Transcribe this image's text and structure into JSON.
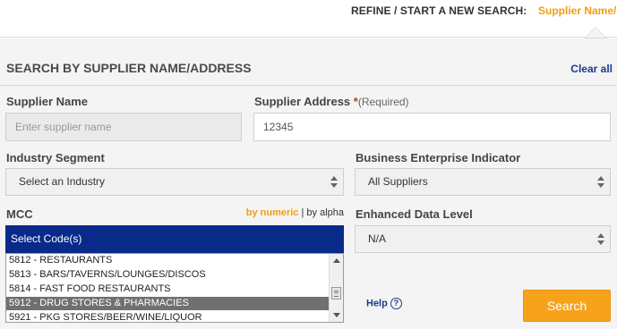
{
  "topbar": {
    "refine_label": "REFINE / START A NEW SEARCH:",
    "active_tab": "Supplier Name/"
  },
  "panel": {
    "title": "SEARCH BY SUPPLIER NAME/ADDRESS",
    "clear_all": "Clear all"
  },
  "supplier_name": {
    "label": "Supplier Name",
    "placeholder": "Enter supplier name",
    "value": ""
  },
  "supplier_address": {
    "label": "Supplier Address",
    "required_mark": "*",
    "required_text": "(Required)",
    "value": "12345"
  },
  "industry_segment": {
    "label": "Industry Segment",
    "selected": "Select an Industry"
  },
  "business_enterprise": {
    "label": "Business Enterprise Indicator",
    "selected": "All Suppliers"
  },
  "mcc": {
    "label": "MCC",
    "sort_numeric": "by numeric",
    "separator": "|",
    "sort_alpha": "by alpha",
    "header": "Select Code(s)",
    "items": [
      "5812 - RESTAURANTS",
      "5813 - BARS/TAVERNS/LOUNGES/DISCOS",
      "5814 - FAST FOOD RESTAURANTS",
      "5912 - DRUG STORES & PHARMACIES",
      "5921 - PKG STORES/BEER/WINE/LIQUOR"
    ],
    "selected_item": "5912 - DRUG STORES & PHARMACIES"
  },
  "enhanced_data": {
    "label": "Enhanced Data Level",
    "selected": "N/A"
  },
  "help": {
    "label": "Help",
    "icon_glyph": "?"
  },
  "search_button": "Search",
  "colors": {
    "accent_orange": "#f7a21b",
    "link_blue": "#1a3a8c",
    "header_navy": "#0a2a8a"
  }
}
